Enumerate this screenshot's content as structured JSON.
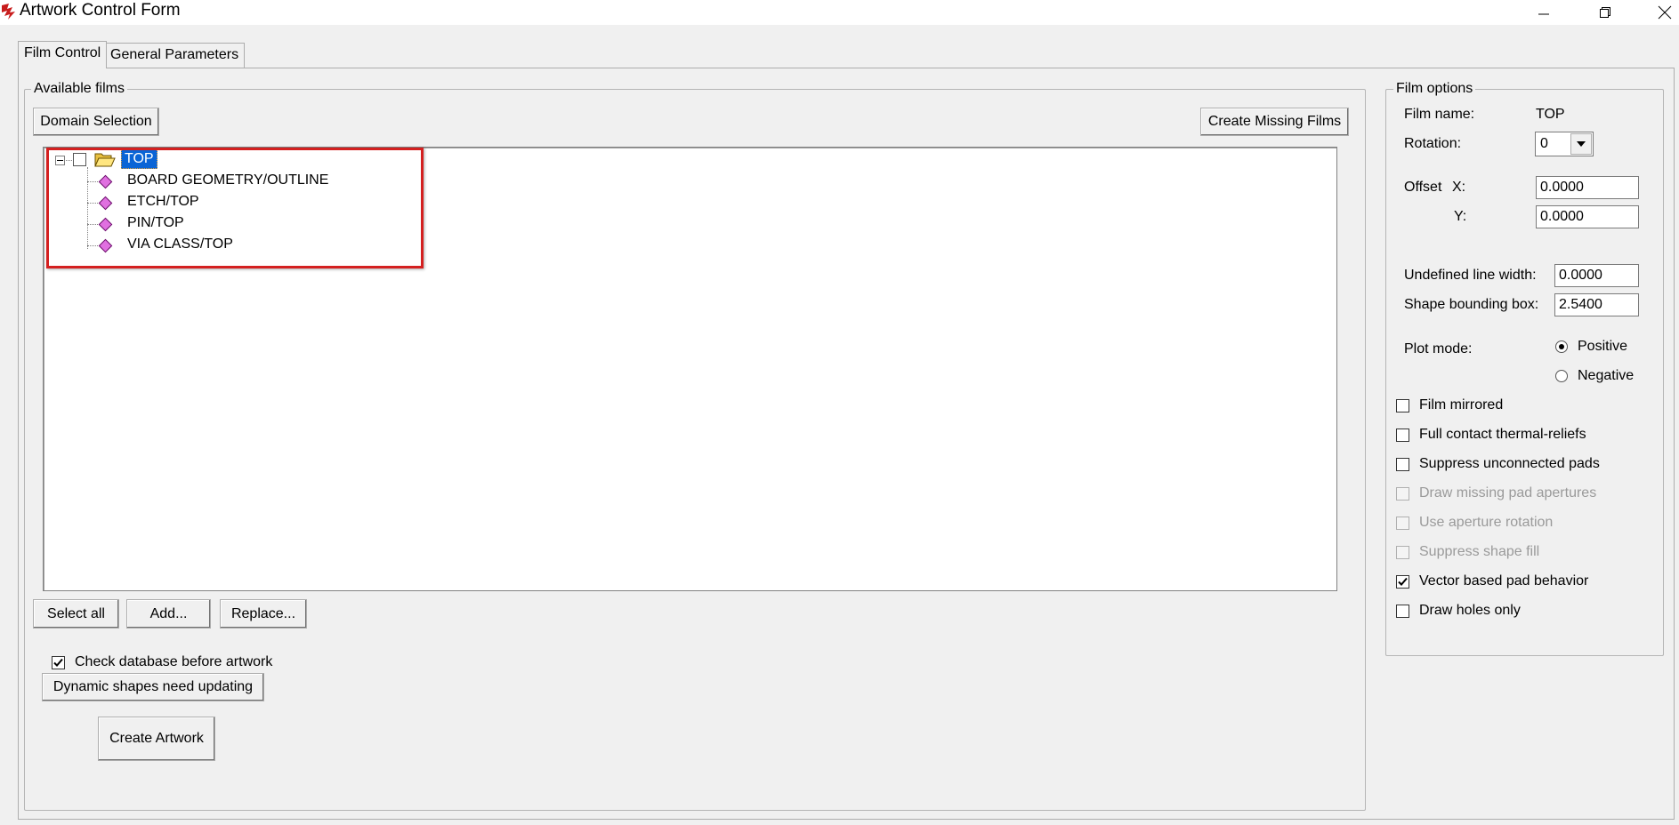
{
  "window": {
    "title": "Artwork Control Form",
    "app_icon": "cadence-logo-icon",
    "controls": [
      "minimize-icon",
      "restore-icon",
      "close-icon"
    ]
  },
  "tabs": [
    {
      "label": "Film Control",
      "active": true
    },
    {
      "label": "General Parameters",
      "active": false
    }
  ],
  "available_films": {
    "legend": "Available films",
    "domain_selection_label": "Domain Selection",
    "create_missing_label": "Create Missing Films",
    "tree": {
      "root": {
        "label": "TOP",
        "expanded": true,
        "checked": false,
        "selected": true,
        "icon": "open-folder-icon"
      },
      "children": [
        {
          "label": "BOARD GEOMETRY/OUTLINE",
          "icon": "layer-diamond-icon"
        },
        {
          "label": "ETCH/TOP",
          "icon": "layer-diamond-icon"
        },
        {
          "label": "PIN/TOP",
          "icon": "layer-diamond-icon"
        },
        {
          "label": "VIA CLASS/TOP",
          "icon": "layer-diamond-icon"
        }
      ]
    },
    "select_all_label": "Select all",
    "add_label": "Add...",
    "replace_label": "Replace...",
    "check_db": {
      "label": "Check database before artwork",
      "checked": true
    },
    "dynamic_shapes_label": "Dynamic shapes need updating",
    "create_artwork_label": "Create Artwork"
  },
  "film_options": {
    "legend": "Film options",
    "film_name_label": "Film name:",
    "film_name_value": "TOP",
    "rotation_label": "Rotation:",
    "rotation_value": "0",
    "offset_label": "Offset",
    "x_label": "X:",
    "x_value": "0.0000",
    "y_label": "Y:",
    "y_value": "0.0000",
    "undefined_line_width_label": "Undefined line width:",
    "undefined_line_width_value": "0.0000",
    "shape_bbox_label": "Shape bounding box:",
    "shape_bbox_value": "2.5400",
    "plot_mode_label": "Plot mode:",
    "plot_mode_options": [
      {
        "label": "Positive",
        "selected": true
      },
      {
        "label": "Negative",
        "selected": false
      }
    ],
    "checkboxes": [
      {
        "label": "Film mirrored",
        "checked": false,
        "enabled": true
      },
      {
        "label": "Full contact thermal-reliefs",
        "checked": false,
        "enabled": true
      },
      {
        "label": "Suppress unconnected pads",
        "checked": false,
        "enabled": true
      },
      {
        "label": "Draw missing pad apertures",
        "checked": false,
        "enabled": false
      },
      {
        "label": "Use aperture rotation",
        "checked": false,
        "enabled": false
      },
      {
        "label": "Suppress shape fill",
        "checked": false,
        "enabled": false
      },
      {
        "label": "Vector based pad behavior",
        "checked": true,
        "enabled": true
      },
      {
        "label": "Draw holes only",
        "checked": false,
        "enabled": true
      }
    ]
  },
  "colors": {
    "highlight_box": "#d42020",
    "selection": "#0a64d6",
    "layer_icon": "#e070e0"
  }
}
